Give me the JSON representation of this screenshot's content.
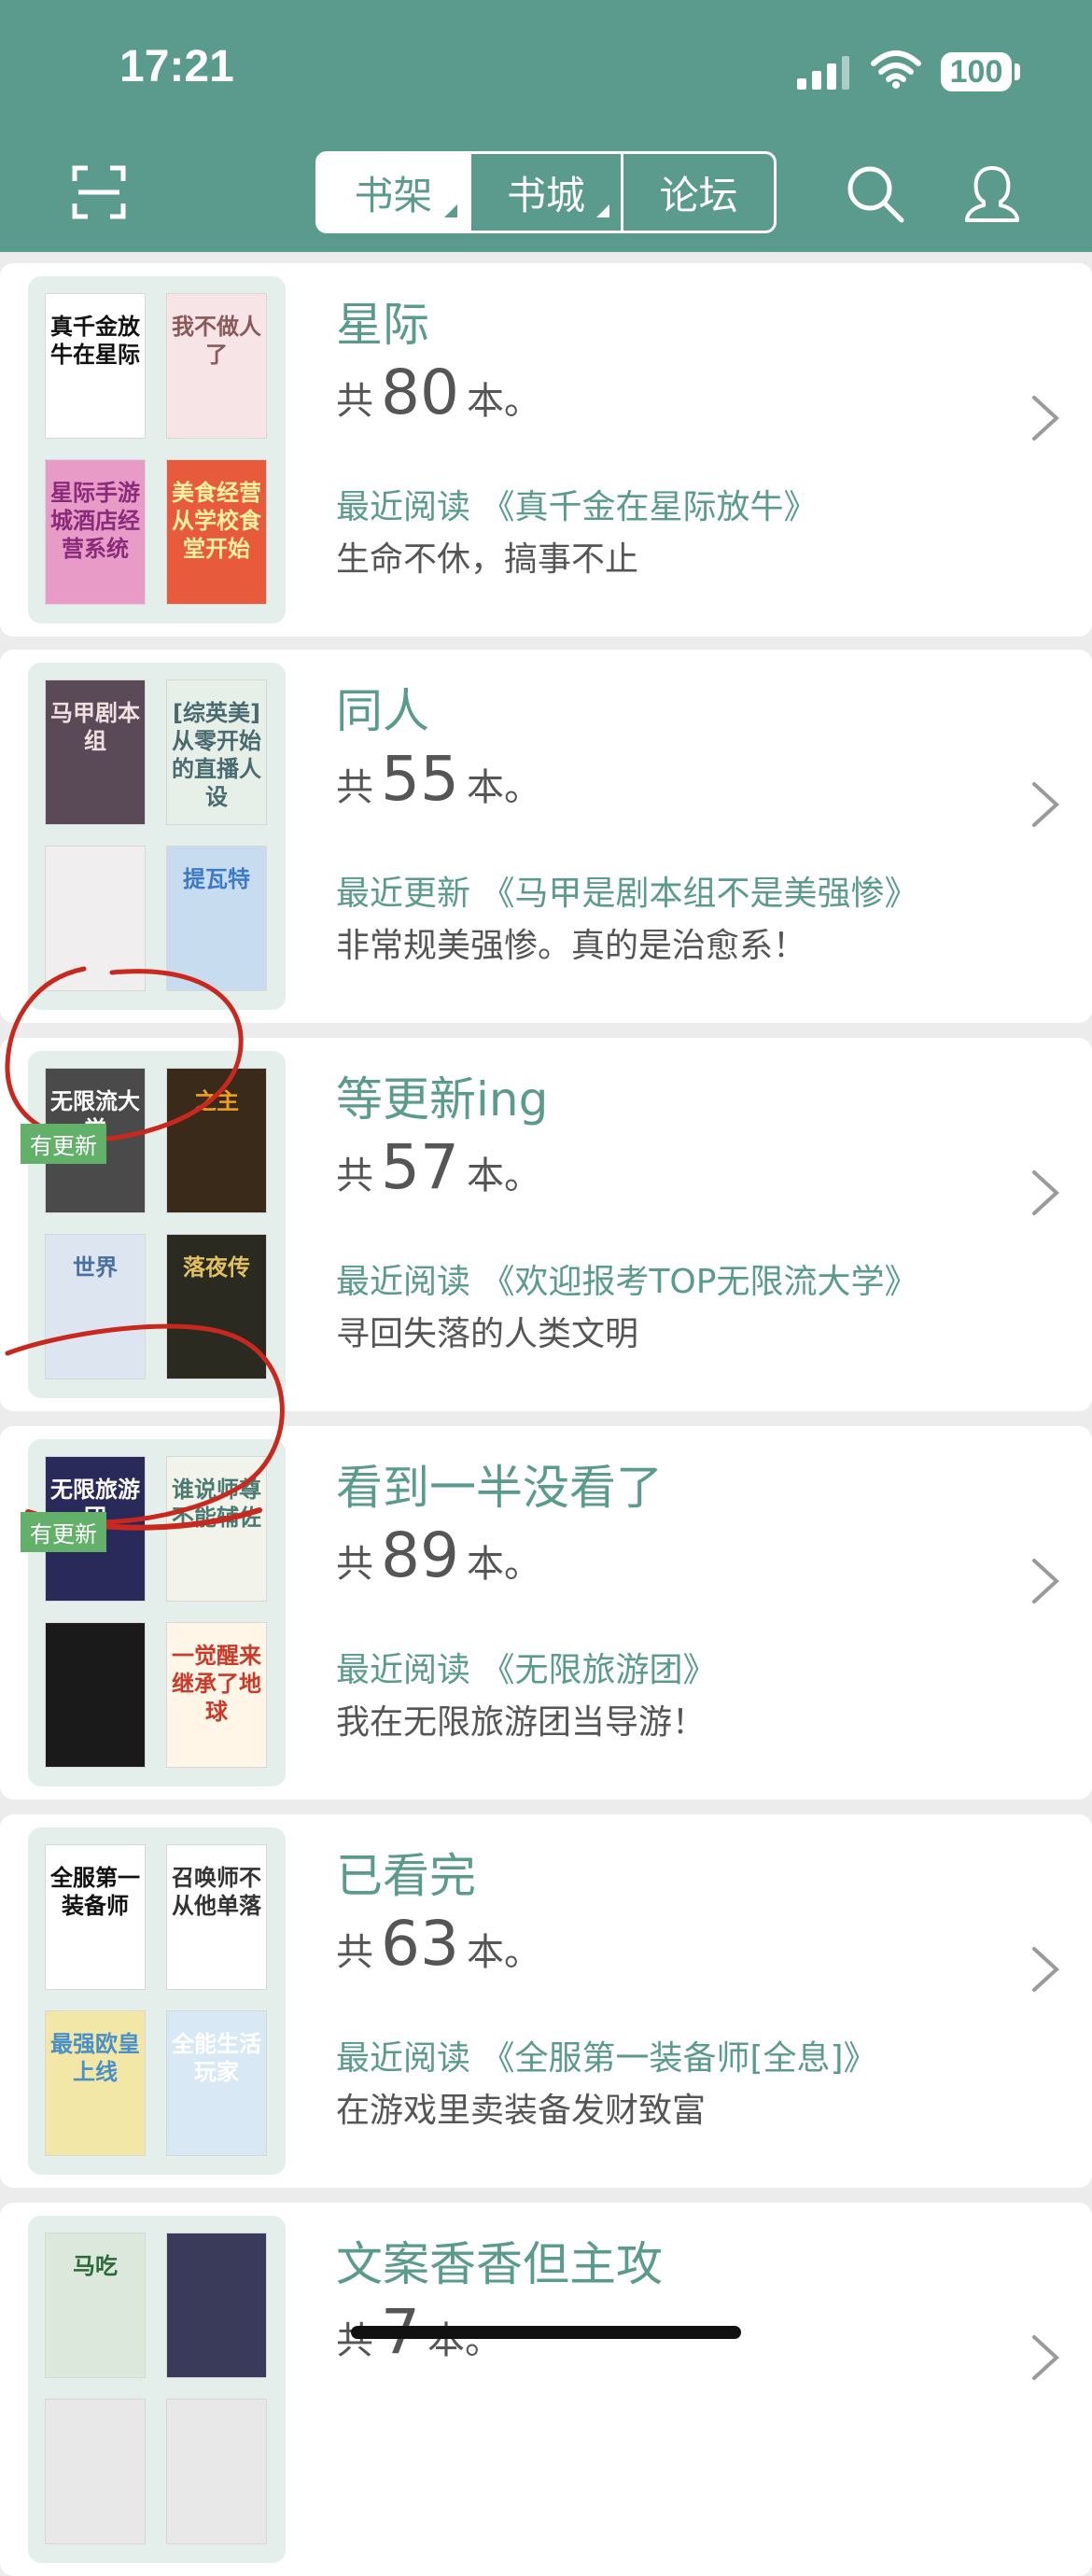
{
  "status_bar": {
    "time": "17:21",
    "battery": "100"
  },
  "nav": {
    "tabs": [
      {
        "label": "书架",
        "active": true
      },
      {
        "label": "书城",
        "active": false
      },
      {
        "label": "论坛",
        "active": false
      }
    ]
  },
  "groups": [
    {
      "title": "星际",
      "count_prefix": "共",
      "count": "80",
      "count_suffix": "本。",
      "recent": "最近阅读 《真千金在星际放牛》",
      "desc": "生命不休，搞事不止",
      "covers": [
        {
          "title": "真千金放牛在星际",
          "has_badge": false,
          "bg": "#ffffff",
          "fg": "#111111"
        },
        {
          "title": "我不做人了",
          "has_badge": false,
          "bg": "#f7e4e6",
          "fg": "#8a5a5a"
        },
        {
          "title": "星际手游城酒店经营系统",
          "has_badge": false,
          "bg": "#e79bc6",
          "fg": "#8a2a7a"
        },
        {
          "title": "美食经营从学校食堂开始",
          "has_badge": false,
          "bg": "#e85a3c",
          "fg": "#fff2a0"
        }
      ]
    },
    {
      "title": "同人",
      "count_prefix": "共",
      "count": "55",
      "count_suffix": "本。",
      "recent": "最近更新 《马甲是剧本组不是美强惨》",
      "desc": "非常规美强惨。真的是治愈系！",
      "covers": [
        {
          "title": "马甲剧本组",
          "has_badge": false,
          "bg": "#5a4a58",
          "fg": "#f0e0e0"
        },
        {
          "title": "[综英美]从零开始的直播人设",
          "has_badge": false,
          "bg": "#e7f0e8",
          "fg": "#4a6a70"
        },
        {
          "title": "",
          "has_badge": false,
          "bg": "#f1eef0",
          "fg": "#a33"
        },
        {
          "title": "提瓦特",
          "has_badge": false,
          "bg": "#c8dcf0",
          "fg": "#3a7ac8"
        }
      ]
    },
    {
      "title": "等更新ing",
      "count_prefix": "共",
      "count": "57",
      "count_suffix": "本。",
      "recent": "最近阅读 《欢迎报考TOP无限流大学》",
      "desc": "寻回失落的人类文明",
      "covers": [
        {
          "title": "无限流大学",
          "has_badge": true,
          "badge": "有更新",
          "bg": "#4a4a4a",
          "fg": "#ffffff"
        },
        {
          "title": "之主",
          "has_badge": false,
          "bg": "#3a2a1a",
          "fg": "#f0a020"
        },
        {
          "title": "世界",
          "has_badge": false,
          "bg": "#dde6f0",
          "fg": "#4a70a0"
        },
        {
          "title": "落夜传",
          "has_badge": false,
          "bg": "#2a2a20",
          "fg": "#e0c060"
        }
      ]
    },
    {
      "title": "看到一半没看了",
      "count_prefix": "共",
      "count": "89",
      "count_suffix": "本。",
      "recent": "最近阅读 《无限旅游团》",
      "desc": "我在无限旅游团当导游！",
      "covers": [
        {
          "title": "无限旅游团",
          "has_badge": true,
          "badge": "有更新",
          "bg": "#2a2a5a",
          "fg": "#ffffff"
        },
        {
          "title": "谁说师尊不能辅佐",
          "has_badge": false,
          "bg": "#f2f4ec",
          "fg": "#4a7a70"
        },
        {
          "title": "",
          "has_badge": false,
          "bg": "#1a1a1a",
          "fg": "#e0a0c0"
        },
        {
          "title": "一觉醒来继承了地球",
          "has_badge": false,
          "bg": "#fff6e8",
          "fg": "#c83a2a"
        }
      ]
    },
    {
      "title": "已看完",
      "count_prefix": "共",
      "count": "63",
      "count_suffix": "本。",
      "recent": "最近阅读 《全服第一装备师[全息]》",
      "desc": "在游戏里卖装备发财致富",
      "covers": [
        {
          "title": "全服第一装备师",
          "has_badge": false,
          "bg": "#ffffff",
          "fg": "#111111"
        },
        {
          "title": "召唤师不从他单落",
          "has_badge": false,
          "bg": "#ffffff",
          "fg": "#333333"
        },
        {
          "title": "最强欧皇上线",
          "has_badge": false,
          "bg": "#f3e7a8",
          "fg": "#4a90c8"
        },
        {
          "title": "全能生活玩家",
          "has_badge": false,
          "bg": "#d8e8f4",
          "fg": "#ffffff"
        }
      ]
    },
    {
      "title": "文案香香但主攻",
      "count_prefix": "共",
      "count": "7",
      "count_suffix": "本。",
      "recent": "",
      "desc": "",
      "covers": [
        {
          "title": "马吃",
          "has_badge": false,
          "bg": "#dde8dc",
          "fg": "#2a6a3a"
        },
        {
          "title": "",
          "has_badge": false,
          "bg": "#3a3a5a",
          "fg": "#ffffff"
        },
        {
          "title": "",
          "has_badge": false,
          "bg": "#e8e8e8",
          "fg": "#333333"
        },
        {
          "title": "",
          "has_badge": false,
          "bg": "#e8e8e8",
          "fg": "#333333"
        }
      ]
    }
  ]
}
